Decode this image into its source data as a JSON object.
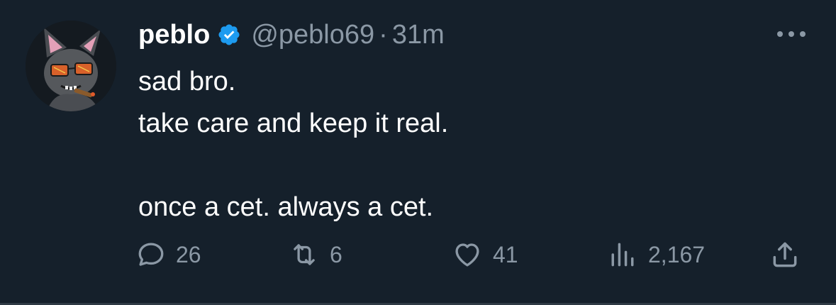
{
  "tweet": {
    "author": {
      "display_name": "peblo",
      "handle": "@peblo69",
      "verified": true
    },
    "separator": "·",
    "timestamp": "31m",
    "text_lines": [
      "sad bro.",
      "take care and keep it real.",
      "",
      "once a cet. always a cet."
    ],
    "stats": {
      "replies": "26",
      "retweets": "6",
      "likes": "41",
      "views": "2,167"
    }
  },
  "icons": {
    "verified": "verified-badge-icon",
    "more": "more-dots-icon",
    "reply": "reply-icon",
    "retweet": "retweet-icon",
    "like": "heart-icon",
    "views": "views-chart-icon",
    "share": "share-icon"
  },
  "colors": {
    "background": "#15202b",
    "text_primary": "#ffffff",
    "text_secondary": "#8b98a5",
    "verified_blue": "#1d9bf0"
  }
}
